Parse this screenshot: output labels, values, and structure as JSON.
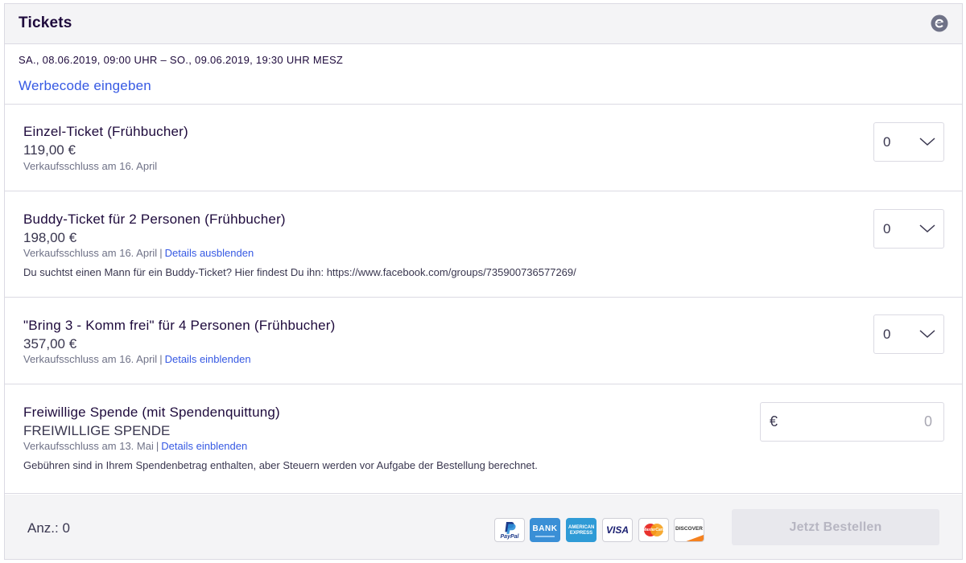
{
  "header": {
    "title": "Tickets",
    "brand_icon": "eventbrite-e-icon",
    "brand_color": "#6f7287"
  },
  "event": {
    "date_range": "SA., 08.06.2019, 09:00 UHR – SO., 09.06.2019, 19:30 UHR MESZ",
    "promo_link": "Werbecode eingeben"
  },
  "tickets": [
    {
      "name": "Einzel-Ticket (Frühbucher)",
      "price": "119,00 €",
      "sales_end": "Verkaufsschluss am 16. April",
      "details_link": "",
      "description": "",
      "quantity": "0"
    },
    {
      "name": "Buddy-Ticket für 2 Personen (Frühbucher)",
      "price": "198,00 €",
      "sales_end": "Verkaufsschluss am 16. April",
      "details_link": "Details ausblenden",
      "description": "Du suchtst einen Mann für ein Buddy-Ticket? Hier findest Du ihn: https://www.facebook.com/groups/735900736577269/",
      "quantity": "0"
    },
    {
      "name": "\"Bring 3 - Komm frei\" für 4 Personen (Frühbucher)",
      "price": "357,00 €",
      "sales_end": "Verkaufsschluss am 16. April",
      "details_link": "Details einblenden",
      "description": "",
      "quantity": "0"
    }
  ],
  "donation": {
    "name": "Freiwillige Spende (mit Spendenquittung)",
    "subtitle": "FREIWILLIGE SPENDE",
    "sales_end": "Verkaufsschluss am 13. Mai",
    "details_link": "Details einblenden",
    "description": "Gebühren sind in Ihrem Spendenbetrag enthalten, aber Steuern werden vor Aufgabe der Bestellung berechnet.",
    "currency": "€",
    "placeholder": "0"
  },
  "footer": {
    "quantity_label": "Anz.: 0",
    "payment_methods": [
      {
        "icon": "paypal-icon",
        "label": "PayPal"
      },
      {
        "icon": "bank-icon",
        "label": "BANK"
      },
      {
        "icon": "amex-icon",
        "label": "AMERICAN EXPRESS"
      },
      {
        "icon": "visa-icon",
        "label": "VISA"
      },
      {
        "icon": "mastercard-icon",
        "label": "MasterCard"
      },
      {
        "icon": "discover-icon",
        "label": "DISCOVER"
      }
    ],
    "order_button": "Jetzt Bestellen"
  },
  "colors": {
    "link": "#3659e3",
    "text": "#39364f",
    "heading": "#1e0a3c",
    "muted": "#6f7287",
    "border": "#dbdae3"
  }
}
